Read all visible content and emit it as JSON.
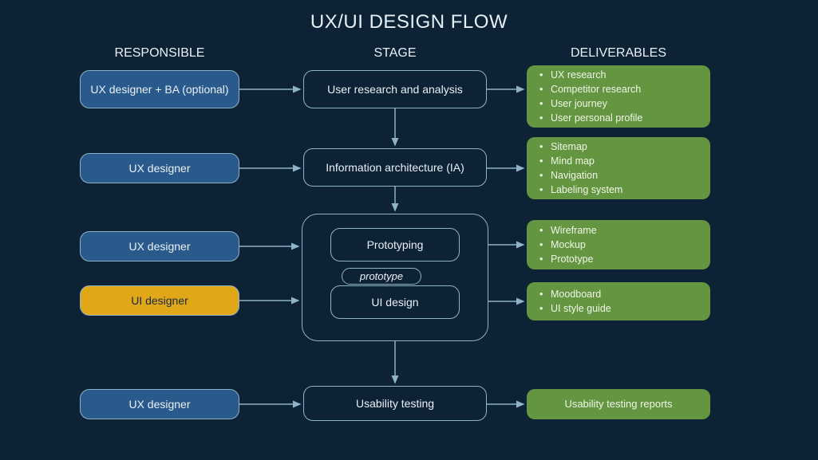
{
  "title": "UX/UI DESIGN FLOW",
  "columns": {
    "responsible": "RESPONSIBLE",
    "stage": "STAGE",
    "deliverables": "DELIVERABLES"
  },
  "rows": [
    {
      "responsible": "UX designer + BA (optional)",
      "stage": "User research and analysis",
      "deliverables": [
        "UX research",
        "Competitor research",
        "User journey",
        "User personal profile"
      ]
    },
    {
      "responsible": "UX designer",
      "stage": "Information architecture (IA)",
      "deliverables": [
        "Sitemap",
        "Mind map",
        "Navigation",
        "Labeling system"
      ]
    },
    {
      "responsible": "UX designer",
      "stage": "Prototyping",
      "deliverables": [
        "Wireframe",
        "Mockup",
        "Prototype"
      ]
    },
    {
      "responsible": "UI designer",
      "stage": "UI design",
      "deliverables": [
        "Moodboard",
        "UI style guide"
      ]
    },
    {
      "responsible": "UX designer",
      "stage": "Usability testing",
      "deliverables_single": "Usability testing reports"
    }
  ],
  "prototype_label": "prototype"
}
